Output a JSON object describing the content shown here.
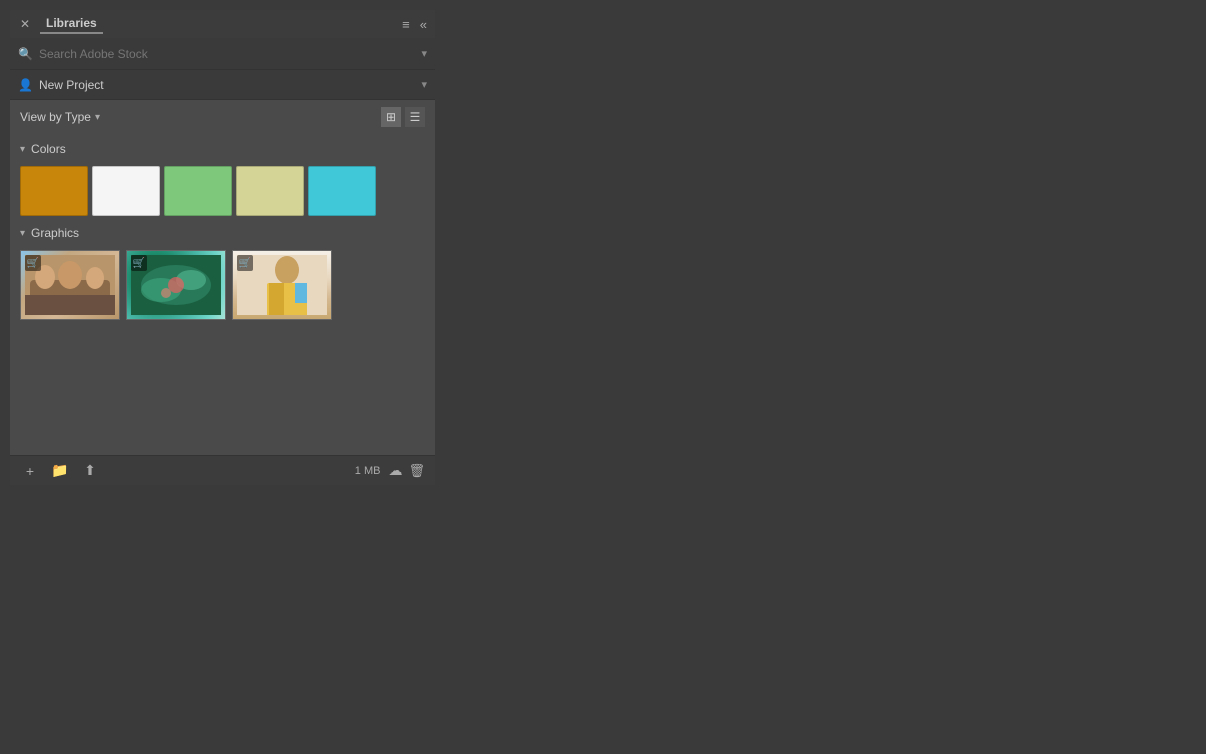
{
  "panel": {
    "title": "Libraries",
    "search_placeholder": "Search Adobe Stock",
    "project_name": "New Project",
    "view_by_type_label": "View by Type",
    "colors_section_label": "Colors",
    "graphics_section_label": "Graphics",
    "storage_size": "1 MB",
    "colors": [
      {
        "id": "c1",
        "value": "#c8860a",
        "label": "Gold"
      },
      {
        "id": "c2",
        "value": "#f5f5f5",
        "label": "White"
      },
      {
        "id": "c3",
        "value": "#7dc87a",
        "label": "Green"
      },
      {
        "id": "c4",
        "value": "#d4d496",
        "label": "Khaki"
      },
      {
        "id": "c5",
        "value": "#40c8d8",
        "label": "Cyan"
      }
    ],
    "graphics": [
      {
        "id": "g1",
        "class": "img1",
        "label": "Family photo"
      },
      {
        "id": "g2",
        "class": "img2",
        "label": "Aerial ocean"
      },
      {
        "id": "g3",
        "class": "img3",
        "label": "Woman portrait"
      }
    ]
  },
  "icons": {
    "close": "✕",
    "collapse": "«",
    "menu": "≡",
    "search": "🔍",
    "chevron_down": "▾",
    "chevron_right": "▸",
    "add_user": "👤",
    "grid": "⊞",
    "list": "☰",
    "plus": "+",
    "folder": "📁",
    "upload": "⬆",
    "cloud": "☁",
    "trash": "🗑",
    "cart": "🛒"
  }
}
